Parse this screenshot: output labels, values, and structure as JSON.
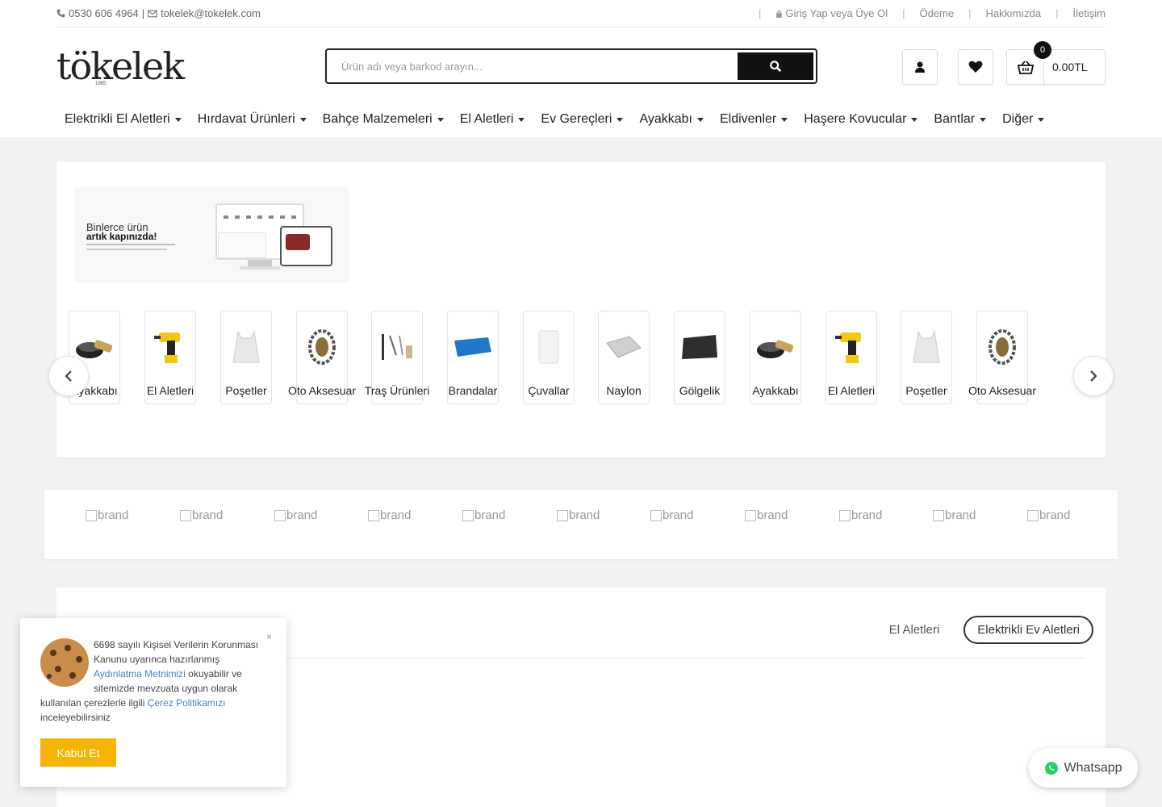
{
  "topbar": {
    "phone": "0530 606 4964",
    "separator": "|",
    "email": "tokelek@tokelek.com",
    "login": "Giriş Yap veya Üye Ol",
    "links": [
      "Ödeme",
      "Hakkımızda",
      "İletişim"
    ]
  },
  "header": {
    "logo": "tökelek",
    "logo_sub": "1965",
    "search_placeholder": "Ürün adı veya barkod arayın...",
    "cart_count": "0",
    "cart_total": "0.00TL"
  },
  "nav": [
    "Elektrikli El Aletleri",
    "Hırdavat Ürünleri",
    "Bahçe Malzemeleri",
    "El Aletleri",
    "Ev Gereçleri",
    "Ayakkabı",
    "Eldivenler",
    "Haşere Kovucular",
    "Bantlar",
    "Diğer"
  ],
  "promo": {
    "line1": "Binlerce ürün",
    "line2": "artık kapınızda!"
  },
  "categories": [
    {
      "label": "Ayakkabı",
      "icon": "shoe-care-icon"
    },
    {
      "label": "El Aletleri",
      "icon": "drill-icon"
    },
    {
      "label": "Poşetler",
      "icon": "bag-icon"
    },
    {
      "label": "Oto Aksesuar",
      "icon": "tire-chain-icon"
    },
    {
      "label": "Traş Ürünleri",
      "icon": "razor-icon"
    },
    {
      "label": "Brandalar",
      "icon": "tarp-icon"
    },
    {
      "label": "Çuvallar",
      "icon": "sack-icon"
    },
    {
      "label": "Naylon",
      "icon": "nylon-icon"
    },
    {
      "label": "Gölgelik",
      "icon": "shade-net-icon"
    },
    {
      "label": "Ayakkabı",
      "icon": "shoe-care-icon"
    },
    {
      "label": "El Aletleri",
      "icon": "drill-icon"
    },
    {
      "label": "Poşetler",
      "icon": "bag-icon"
    },
    {
      "label": "Oto Aksesuar",
      "icon": "tire-chain-icon"
    }
  ],
  "brands": [
    "brand",
    "brand",
    "brand",
    "brand",
    "brand",
    "brand",
    "brand",
    "brand",
    "brand",
    "brand",
    "brand"
  ],
  "product_tabs": [
    "El Aletleri",
    "Elektrikli Ev Aletleri"
  ],
  "cookie": {
    "text_1": "6698 sayılı Kişisel Verilerin Korunması Kanunu uyarınca hazırlanmış ",
    "link_1": "Aydınlatma Metnimizi",
    "text_2": " okuyabilir ve sitemizde mevzuata uygun olarak kullanılan çerezlerle ilgili ",
    "link_2": "Çerez Politikamızı",
    "text_3": " inceleyebilirsiniz",
    "close": "×",
    "accept": "Kabul Et"
  },
  "whatsapp": "Whatsapp",
  "colors": {
    "accent": "#f5b400",
    "link": "#4a7fc4",
    "dark": "#111111",
    "whatsapp": "#25d366"
  }
}
